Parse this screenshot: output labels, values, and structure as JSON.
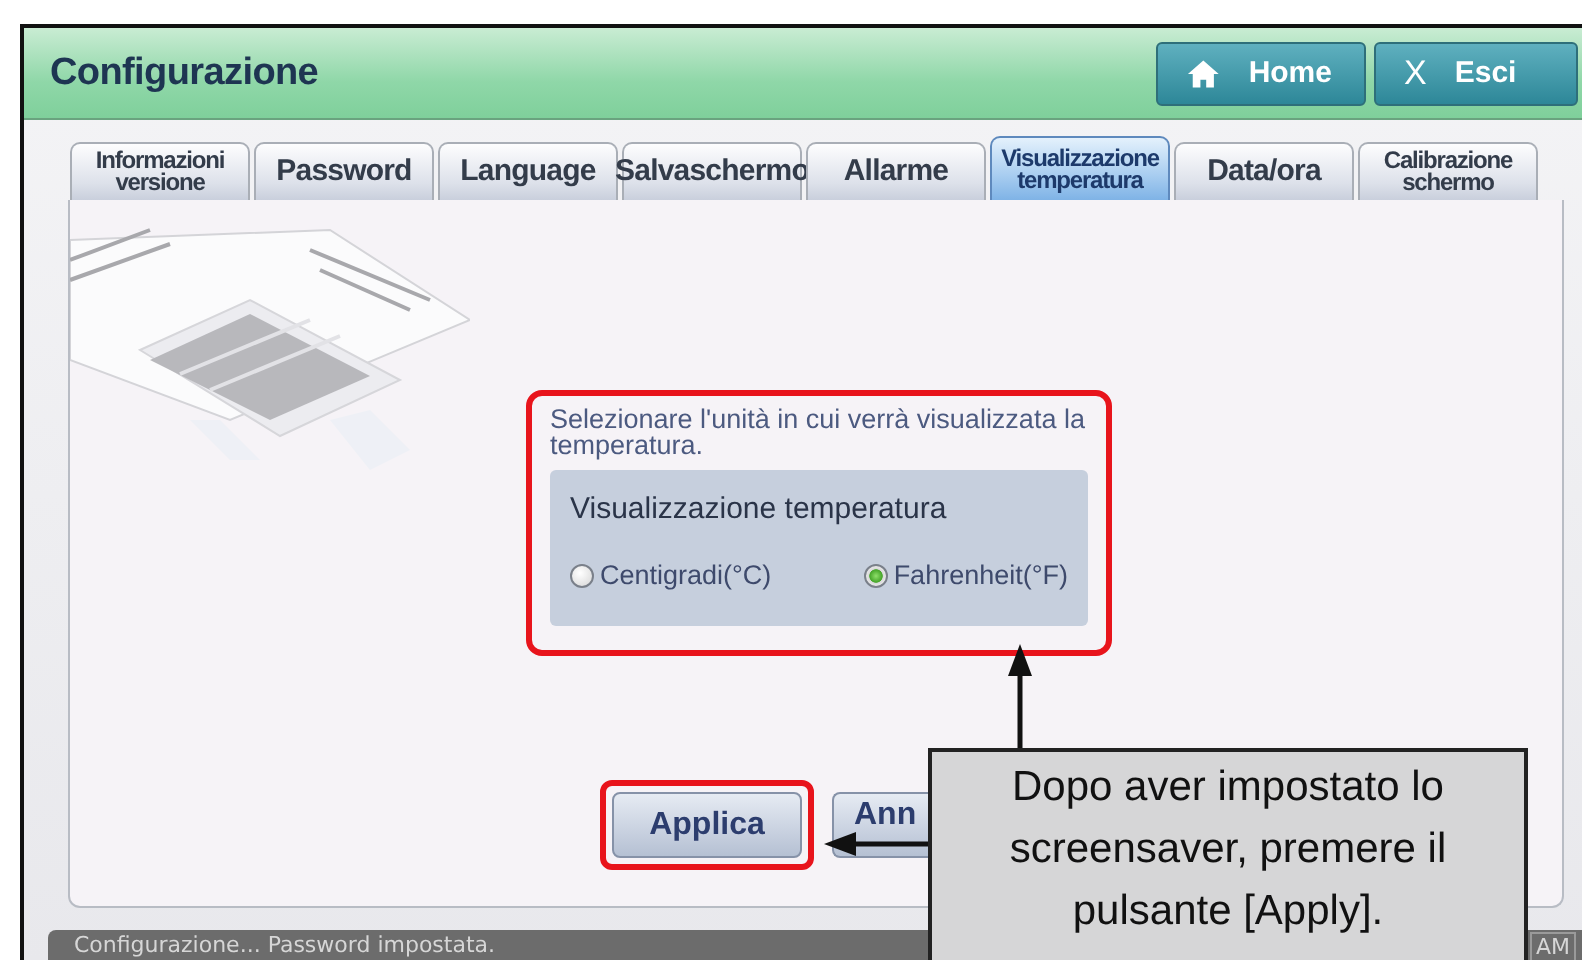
{
  "window": {
    "title": "Configurazione"
  },
  "header_buttons": [
    {
      "kind": "home",
      "label": "Home"
    },
    {
      "kind": "exit",
      "icon_text": "X",
      "label": "Esci"
    }
  ],
  "tabs": [
    {
      "label": "Informazioni versione",
      "selected": false
    },
    {
      "label": "Password",
      "selected": false
    },
    {
      "label": "Language",
      "selected": false
    },
    {
      "label": "Salvaschermo",
      "selected": false
    },
    {
      "label": "Allarme",
      "selected": false
    },
    {
      "label": "Visualizzazione temperatura",
      "selected": true
    },
    {
      "label": "Data/ora",
      "selected": false
    },
    {
      "label": "Calibrazione schermo",
      "selected": false
    }
  ],
  "panel": {
    "instruction": "Selezionare l'unità in cui verrà visualizzata la temperatura.",
    "group_title": "Visualizzazione temperatura",
    "options": [
      {
        "label": "Centigradi(°C)",
        "selected": false
      },
      {
        "label": "Fahrenheit(°F)",
        "selected": true
      }
    ],
    "buttons": [
      {
        "label": "Applica",
        "highlighted": true
      },
      {
        "label": "Ann",
        "highlighted": false
      }
    ]
  },
  "status_bar": {
    "message": "Configurazione... Password impostata.",
    "time": "AM"
  },
  "callout": {
    "text": "Dopo aver impostato lo screensaver, premere il pulsante [Apply]."
  }
}
